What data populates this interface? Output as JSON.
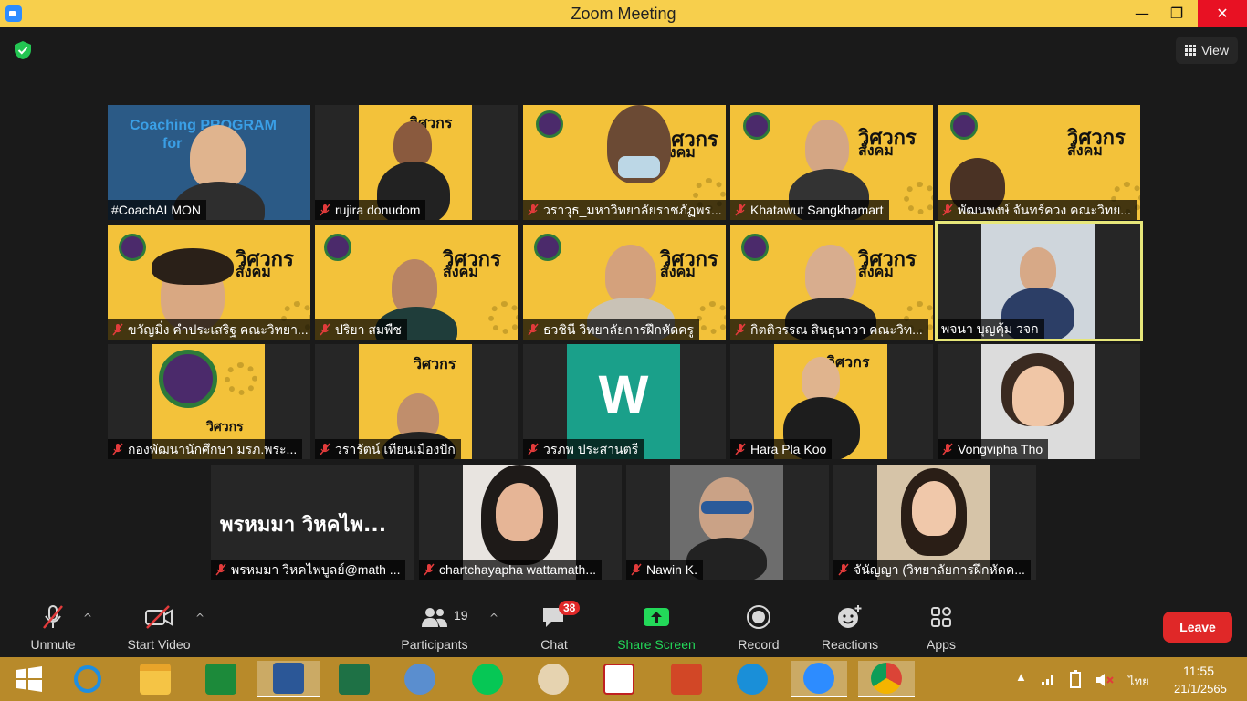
{
  "window": {
    "title": "Zoom Meeting",
    "min": "—",
    "max": "❐",
    "close": "✕"
  },
  "view_label": "View",
  "participants": [
    {
      "name": "#CoachALMON",
      "muted": false
    },
    {
      "name": "rujira donudom",
      "muted": true
    },
    {
      "name": "วราวุธ_มหาวิทยาลัยราชภัฏพร...",
      "muted": true
    },
    {
      "name": "Khatawut Sangkhamart",
      "muted": true
    },
    {
      "name": "พัฒนพงษ์ จันทร์ควง คณะวิทย...",
      "muted": true
    },
    {
      "name": "ขวัญมิ่ง คำประเสริฐ คณะวิทยา...",
      "muted": true
    },
    {
      "name": "ปริยา สมพืช",
      "muted": true
    },
    {
      "name": "ธวชินี  วิทยาลัยการฝึกหัดครู",
      "muted": true
    },
    {
      "name": "กิตติวรรณ สินธุนาวา คณะวิท...",
      "muted": true
    },
    {
      "name": "พจนา บุญคุ้ม วจก",
      "muted": false
    },
    {
      "name": "กองพัฒนานักศึกษา มรภ.พระ...",
      "muted": true
    },
    {
      "name": "วรารัตน์ เทียนเมืองปัก",
      "muted": true
    },
    {
      "name": "วรภพ ประสานตรี",
      "muted": true
    },
    {
      "name": "Hara Pla Koo",
      "muted": true
    },
    {
      "name": "Vongvipha Tho",
      "muted": true
    },
    {
      "name": "พรหมมา วิหคไพบูลย์@math ...",
      "muted": true
    },
    {
      "name": "chartchayapha wattamath...",
      "muted": true
    },
    {
      "name": "Nawin K.",
      "muted": true
    },
    {
      "name": "จันัญญา (วิทยาลัยการฝึกหัดค...",
      "muted": true
    }
  ],
  "tiles_text": {
    "coach_banner": "Coaching PROGRAM",
    "coach_banner2": "for",
    "poster_word": "วิศวกร",
    "poster_word2": "สังคม",
    "avatar_letter": "W",
    "big_name": "พรหมมา วิหคไพ..."
  },
  "toolbar": {
    "unmute": "Unmute",
    "start_video": "Start Video",
    "participants": "Participants",
    "participant_count": "19",
    "chat": "Chat",
    "chat_badge": "38",
    "share_screen": "Share Screen",
    "record": "Record",
    "reactions": "Reactions",
    "apps": "Apps",
    "leave": "Leave"
  },
  "colors": {
    "share_green": "#23d959",
    "leave_red": "#e02828",
    "title_bar": "#f7cf4c",
    "active_border": "#e7e77a"
  },
  "tray": {
    "lang": "ไทย",
    "time": "11:55",
    "date": "21/1/2565"
  }
}
